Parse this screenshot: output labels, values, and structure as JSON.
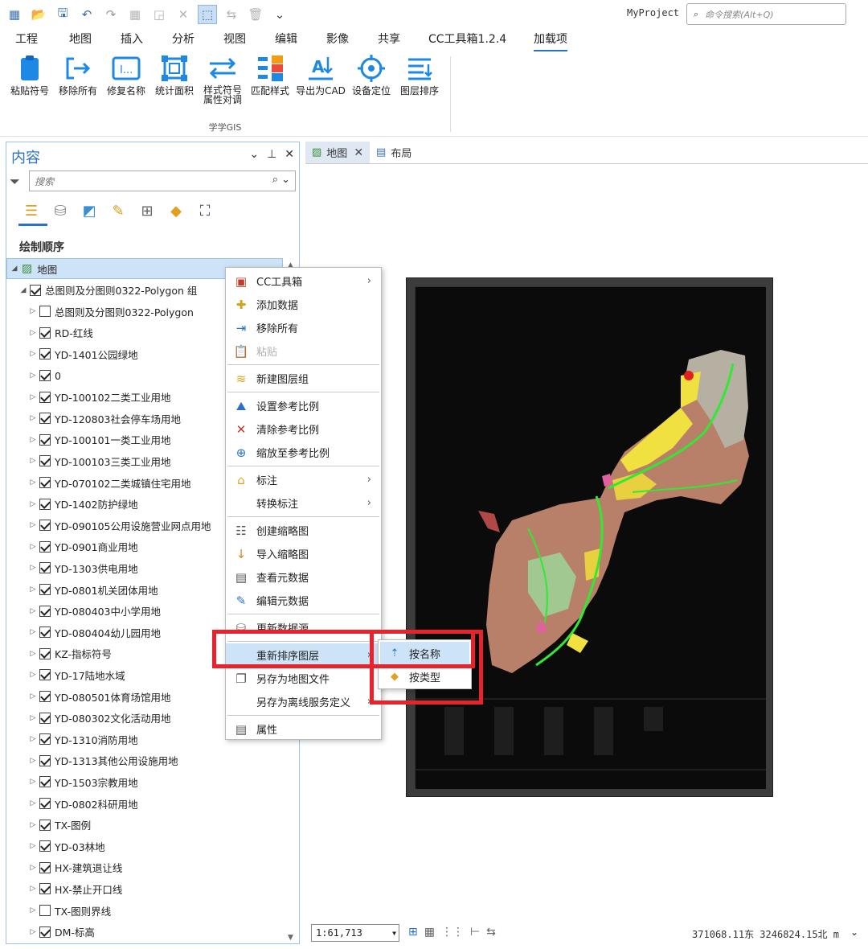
{
  "project_name": "MyProject",
  "command_search_placeholder": "命令搜索(Alt+Q)",
  "ribbon_tabs": [
    "工程",
    "地图",
    "插入",
    "分析",
    "视图",
    "编辑",
    "影像",
    "共享",
    "CC工具箱1.2.4",
    "加载项"
  ],
  "active_ribbon_tab": "加载项",
  "tools": [
    "粘贴符号",
    "移除所有",
    "修复名称",
    "统计面积",
    "样式符号\n属性对调",
    "匹配样式",
    "导出为CAD",
    "设备定位",
    "图层排序"
  ],
  "tool_group": "学学GIS",
  "contents": {
    "title": "内容",
    "search_placeholder": "搜索",
    "drawing_order": "绘制顺序",
    "layers": [
      {
        "label": "地图",
        "level": 0,
        "checkbox": null
      },
      {
        "label": "总图则及分图则0322-Polygon 组",
        "level": 1,
        "checkbox": true
      },
      {
        "label": "总图则及分图则0322-Polygon",
        "level": 2,
        "checkbox": false
      },
      {
        "label": "RD-红线",
        "level": 2,
        "checkbox": true
      },
      {
        "label": "YD-1401公园绿地",
        "level": 2,
        "checkbox": true
      },
      {
        "label": "0",
        "level": 2,
        "checkbox": true
      },
      {
        "label": "YD-100102二类工业用地",
        "level": 2,
        "checkbox": true
      },
      {
        "label": "YD-120803社会停车场用地",
        "level": 2,
        "checkbox": true
      },
      {
        "label": "YD-100101一类工业用地",
        "level": 2,
        "checkbox": true
      },
      {
        "label": "YD-100103三类工业用地",
        "level": 2,
        "checkbox": true
      },
      {
        "label": "YD-070102二类城镇住宅用地",
        "level": 2,
        "checkbox": true
      },
      {
        "label": "YD-1402防护绿地",
        "level": 2,
        "checkbox": true
      },
      {
        "label": "YD-090105公用设施营业网点用地",
        "level": 2,
        "checkbox": true
      },
      {
        "label": "YD-0901商业用地",
        "level": 2,
        "checkbox": true
      },
      {
        "label": "YD-1303供电用地",
        "level": 2,
        "checkbox": true
      },
      {
        "label": "YD-0801机关团体用地",
        "level": 2,
        "checkbox": true
      },
      {
        "label": "YD-080403中小学用地",
        "level": 2,
        "checkbox": true
      },
      {
        "label": "YD-080404幼儿园用地",
        "level": 2,
        "checkbox": true
      },
      {
        "label": "KZ-指标符号",
        "level": 2,
        "checkbox": true
      },
      {
        "label": "YD-17陆地水域",
        "level": 2,
        "checkbox": true
      },
      {
        "label": "YD-080501体育场馆用地",
        "level": 2,
        "checkbox": true
      },
      {
        "label": "YD-080302文化活动用地",
        "level": 2,
        "checkbox": true
      },
      {
        "label": "YD-1310消防用地",
        "level": 2,
        "checkbox": true
      },
      {
        "label": "YD-1313其他公用设施用地",
        "level": 2,
        "checkbox": true
      },
      {
        "label": "YD-1503宗教用地",
        "level": 2,
        "checkbox": true
      },
      {
        "label": "YD-0802科研用地",
        "level": 2,
        "checkbox": true
      },
      {
        "label": "TX-图例",
        "level": 2,
        "checkbox": true
      },
      {
        "label": "YD-03林地",
        "level": 2,
        "checkbox": true
      },
      {
        "label": "HX-建筑退让线",
        "level": 2,
        "checkbox": true
      },
      {
        "label": "HX-禁止开口线",
        "level": 2,
        "checkbox": true
      },
      {
        "label": "TX-图则界线",
        "level": 2,
        "checkbox": false
      },
      {
        "label": "DM-标高",
        "level": 2,
        "checkbox": true
      }
    ]
  },
  "map_tabs": [
    {
      "label": "地图",
      "active": true
    },
    {
      "label": "布局",
      "active": false
    }
  ],
  "context_menu": [
    {
      "label": "CC工具箱",
      "icon": "toolbox-icon",
      "submenu": true
    },
    {
      "label": "添加数据",
      "icon": "add-data-icon"
    },
    {
      "label": "移除所有",
      "icon": "remove-all-icon"
    },
    {
      "label": "粘贴",
      "icon": "paste-icon",
      "disabled": true
    },
    {
      "label": "新建图层组",
      "icon": "new-group-icon",
      "sep_before": true
    },
    {
      "label": "设置参考比例",
      "icon": "set-ref-scale-icon",
      "sep_before": true
    },
    {
      "label": "清除参考比例",
      "icon": "clear-ref-scale-icon"
    },
    {
      "label": "缩放至参考比例",
      "icon": "zoom-ref-scale-icon"
    },
    {
      "label": "标注",
      "icon": "label-icon",
      "submenu": true,
      "sep_before": true
    },
    {
      "label": "转换标注",
      "icon": "",
      "submenu": true
    },
    {
      "label": "创建缩略图",
      "icon": "create-thumb-icon",
      "sep_before": true
    },
    {
      "label": "导入缩略图",
      "icon": "import-thumb-icon"
    },
    {
      "label": "查看元数据",
      "icon": "view-metadata-icon"
    },
    {
      "label": "编辑元数据",
      "icon": "edit-metadata-icon"
    },
    {
      "label": "更新数据源",
      "icon": "update-source-icon",
      "sep_before": true
    },
    {
      "label": "重新排序图层",
      "icon": "",
      "submenu": true,
      "highlighted": true,
      "sep_before": true
    },
    {
      "label": "另存为地图文件",
      "icon": "save-mapx-icon"
    },
    {
      "label": "另存为离线服务定义",
      "icon": "",
      "submenu": true
    },
    {
      "label": "属性",
      "icon": "properties-icon",
      "sep_before": true
    }
  ],
  "submenu": [
    {
      "label": "按名称",
      "icon": "sort-by-name-icon",
      "highlighted": true
    },
    {
      "label": "按类型",
      "icon": "sort-by-type-icon"
    }
  ],
  "status": {
    "scale": "1:61,713",
    "coordinates": "371068.11东 3246824.15北 m"
  },
  "colors": {
    "accent": "#2a72c8",
    "highlight": "#cde3f7",
    "callout": "#e8232b",
    "map_background": "#0b0b0b"
  }
}
